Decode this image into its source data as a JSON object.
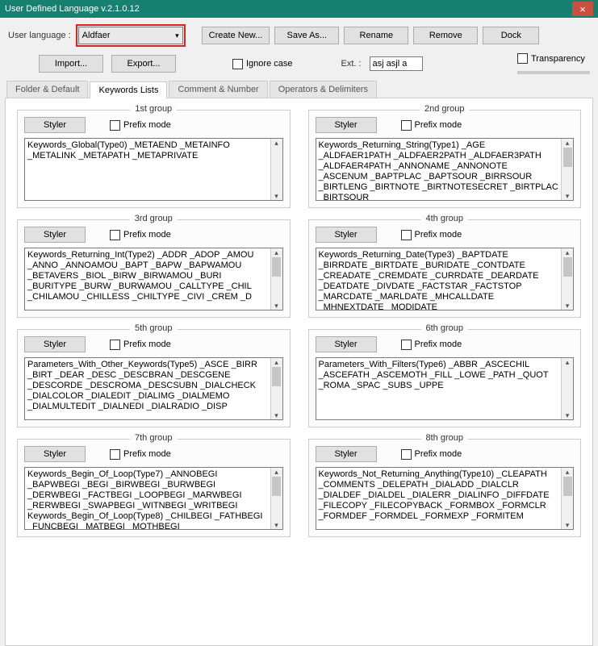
{
  "window": {
    "title": "User Defined Language v.2.1.0.12"
  },
  "toolbar": {
    "user_language_label": "User language :",
    "selected_language": "Aldfaer",
    "create_new": "Create New...",
    "save_as": "Save As...",
    "rename": "Rename",
    "remove": "Remove",
    "dock": "Dock",
    "import": "Import...",
    "export": "Export...",
    "ignore_case": "Ignore case",
    "ext_label": "Ext. :",
    "ext_value": "asj asjl a",
    "transparency": "Transparency"
  },
  "tabs": {
    "folder": "Folder & Default",
    "keywords": "Keywords Lists",
    "comment": "Comment & Number",
    "operators": "Operators & Delimiters"
  },
  "common": {
    "styler": "Styler",
    "prefix": "Prefix mode"
  },
  "groups": [
    {
      "title": "1st group",
      "text": "Keywords_Global(Type0) _METAEND _METAINFO _METALINK _METAPATH _METAPRIVATE",
      "scroll": false
    },
    {
      "title": "2nd group",
      "text": "Keywords_Returning_String(Type1) _AGE _ALDFAER1PATH _ALDFAER2PATH _ALDFAER3PATH _ALDFAER4PATH _ANNONAME _ANNONOTE _ASCENUM _BAPTPLAC _BAPTSOUR _BIRRSOUR _BIRTLENG _BIRTNOTE _BIRTNOTESECRET _BIRTPLAC _BIRTSOUR",
      "scroll": true
    },
    {
      "title": "3rd group",
      "text": "Keywords_Returning_Int(Type2) _ADDR _ADOP _AMOU _ANNO _ANNOAMOU _BAPT _BAPW _BAPWAMOU _BETAVERS _BIOL _BIRW _BIRWAMOU _BURI _BURITYPE _BURW _BURWAMOU _CALLTYPE _CHIL _CHILAMOU _CHILLESS _CHILTYPE _CIVI _CREM _D",
      "scroll": true
    },
    {
      "title": "4th group",
      "text": "Keywords_Returning_Date(Type3) _BAPTDATE _BIRRDATE _BIRTDATE _BURIDATE _CONTDATE _CREADATE _CREMDATE _CURRDATE _DEARDATE _DEATDATE _DIVDATE _FACTSTAR _FACTSTOP _MARCDATE _MARLDATE _MHCALLDATE _MHNEXTDATE _MODIDATE",
      "scroll": true
    },
    {
      "title": "5th group",
      "text": "Parameters_With_Other_Keywords(Type5) _ASCE _BIRR _BIRT _DEAR _DESC _DESCBRAN _DESCGENE _DESCORDE _DESCROMA _DESCSUBN _DIALCHECK _DIALCOLOR _DIALEDIT _DIALIMG _DIALMEMO _DIALMULTEDIT _DIALNEDI _DIALRADIO _DISP",
      "scroll": true
    },
    {
      "title": "6th group",
      "text": "Parameters_With_Filters(Type6) _ABBR _ASCECHIL _ASCEFATH _ASCEMOTH _FILL _LOWE _PATH _QUOT _ROMA _SPAC _SUBS _UPPE",
      "scroll": false
    },
    {
      "title": "7th group",
      "text": "Keywords_Begin_Of_Loop(Type7) _ANNOBEGI _BAPWBEGI _BEGI _BIRWBEGI _BURWBEGI _DERWBEGI _FACTBEGI _LOOPBEGI _MARWBEGI _RERWBEGI _SWAPBEGI _WITNBEGI _WRITBEGI Keywords_Begin_Of_Loop(Type8) _CHILBEGI _FATHBEGI _FUNCBEGI _MATBEGI _MOTHBEGI",
      "scroll": true
    },
    {
      "title": "8th group",
      "text": "Keywords_Not_Returning_Anything(Type10) _CLEAPATH _COMMENTS _DELEPATH _DIALADD _DIALCLR _DIALDEF _DIALDEL _DIALERR _DIALINFO _DIFFDATE _FILECOPY _FILECOPYBACK _FORMBOX _FORMCLR _FORMDEF _FORMDEL _FORMEXP _FORMITEM",
      "scroll": true
    }
  ]
}
